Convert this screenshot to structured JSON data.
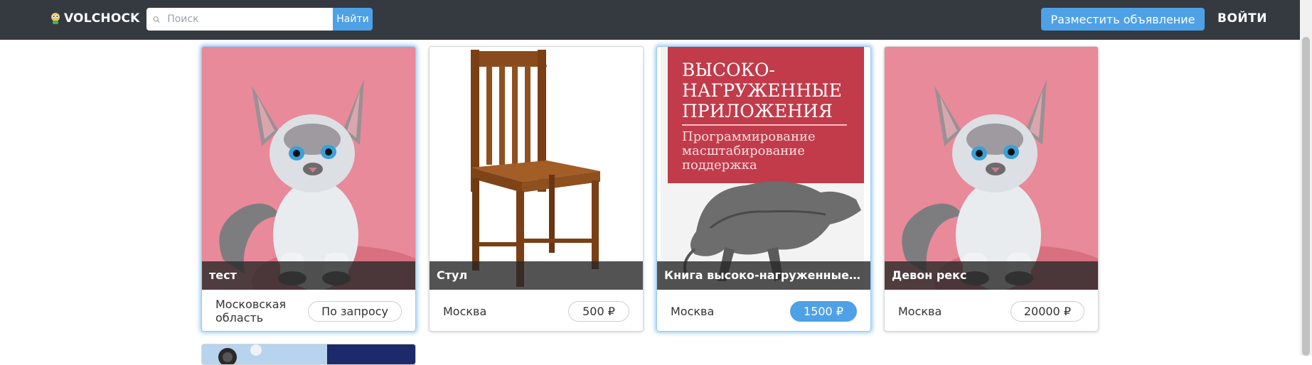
{
  "header": {
    "logo_text": "VOLCHOCK",
    "search_placeholder": "Поиск",
    "search_button": "Найти",
    "post_button": "Разместить объявление",
    "login": "ВОЙТИ"
  },
  "cards": [
    {
      "title": "тест",
      "location": "Московская область",
      "price": "По запросу",
      "image": "kitten-photo"
    },
    {
      "title": "Стул",
      "location": "Москва",
      "price": "500 ₽",
      "image": "wooden-chair-photo"
    },
    {
      "title": "Книга высоко-нагруженные п...",
      "location": "Москва",
      "price": "1500 ₽",
      "image": "book-cover",
      "book_cover": {
        "line1": "ВЫСОКО-",
        "line2": "НАГРУЖЕННЫЕ",
        "line3": "ПРИЛОЖЕНИЯ",
        "sub1": "Программирование",
        "sub2": "масштабирование",
        "sub3": "поддержка"
      }
    },
    {
      "title": "Девон рекс",
      "location": "Москва",
      "price": "20000 ₽",
      "image": "kitten-photo"
    }
  ],
  "colors": {
    "header_bg": "#343a40",
    "accent": "#4ea1e6",
    "kitten_bg": "#e88a99",
    "book_red": "#c23b4a"
  }
}
